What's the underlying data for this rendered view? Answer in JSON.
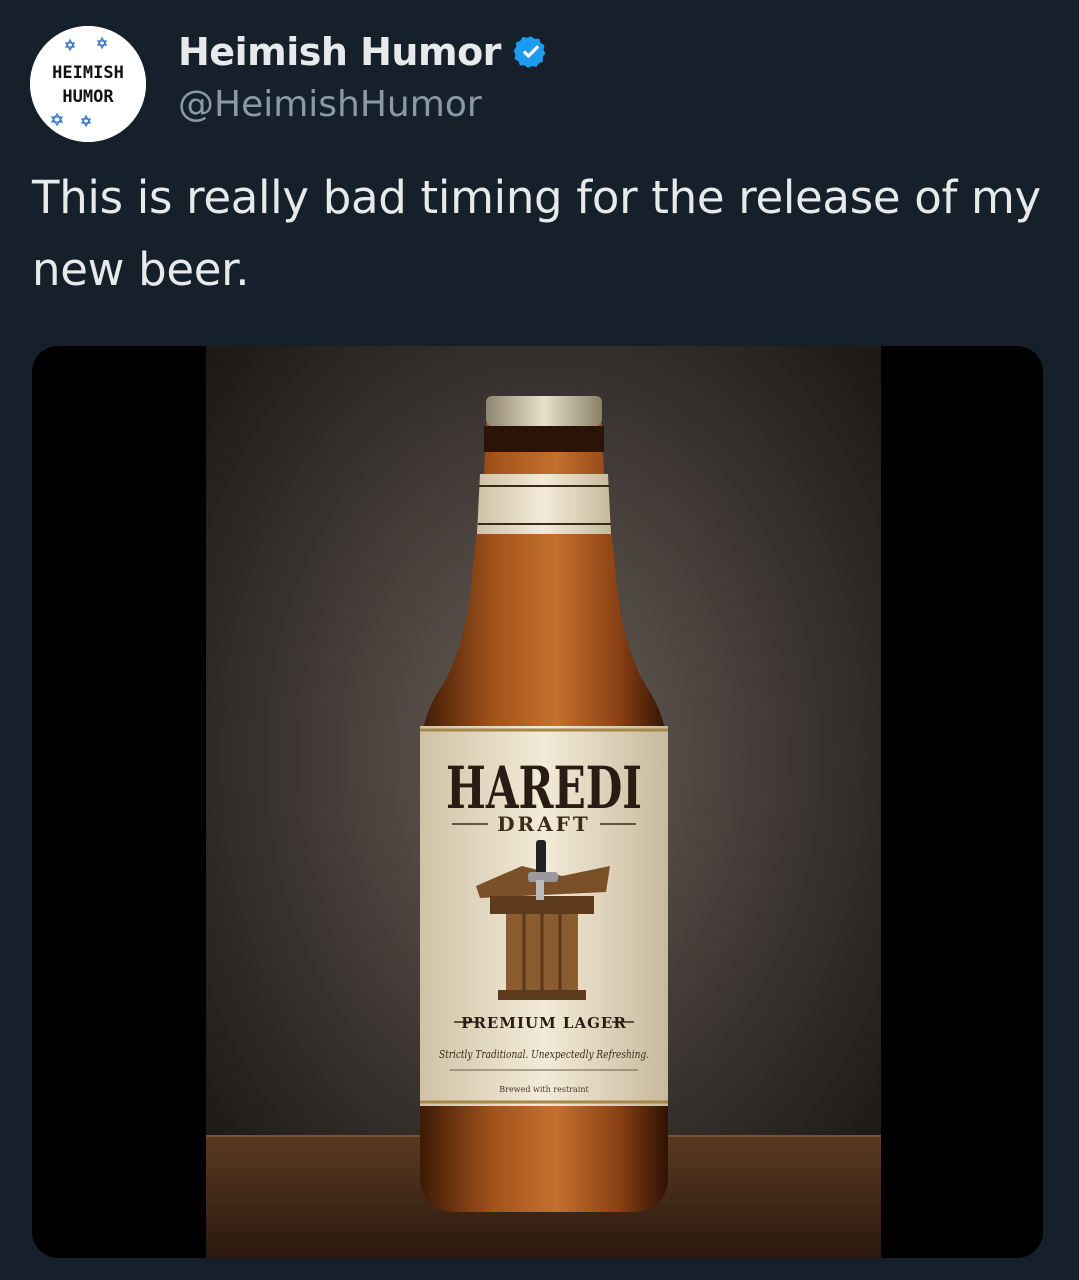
{
  "author": {
    "display_name": "Heimish Humor",
    "handle": "@HeimishHumor",
    "verified": true,
    "avatar_logo_text": [
      "HEIMISH",
      "HUMOR"
    ]
  },
  "tweet": {
    "text": "This is really bad timing for the release of my new beer."
  },
  "media": {
    "label": {
      "brand": "HAREDI",
      "sub": "DRAFT",
      "type": "PREMIUM LAGER",
      "tagline": "Strictly Traditional. Unexpectedly Refreshing.",
      "small_print": "Brewed with restraint"
    }
  },
  "colors": {
    "background": "#15202b",
    "text": "#e7e9ea",
    "secondary_text": "#8b98a5",
    "verified_badge": "#1d9bf0"
  },
  "icons": {
    "verified": "verified-badge-icon"
  }
}
